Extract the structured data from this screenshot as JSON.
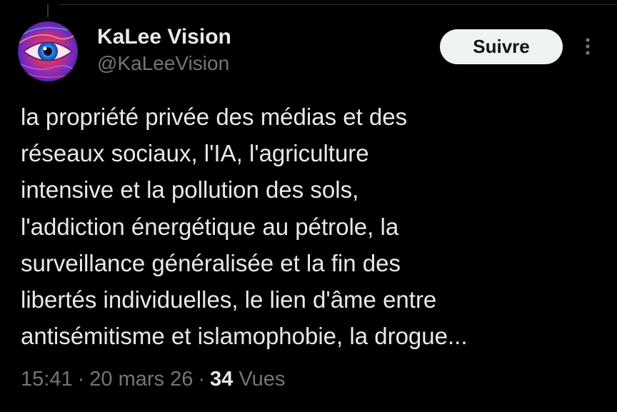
{
  "author": {
    "display_name": "KaLee Vision",
    "handle": "@KaLeeVision",
    "avatar_icon": "eye-avatar-icon"
  },
  "actions": {
    "follow_label": "Suivre",
    "more_icon": "more-vertical-icon"
  },
  "tweet": {
    "text": "la propriété privée des médias et des\nréseaux sociaux, l'IA, l'agriculture\nintensive et la pollution des sols,\nl'addiction énergétique au pétrole, la\nsurveillance généralisée et la fin des\nlibertés individuelles, le lien d'âme entre\nantisémitisme et islamophobie, la drogue..."
  },
  "meta": {
    "time": "15:41",
    "separator": "·",
    "date": "20 mars 26",
    "views_count": "34",
    "views_label": "Vues"
  },
  "colors": {
    "background": "#000000",
    "primary_text": "#e7e9ea",
    "secondary_text": "#71767b",
    "follow_button_bg": "#eff3f4",
    "follow_button_text": "#0f1419"
  }
}
